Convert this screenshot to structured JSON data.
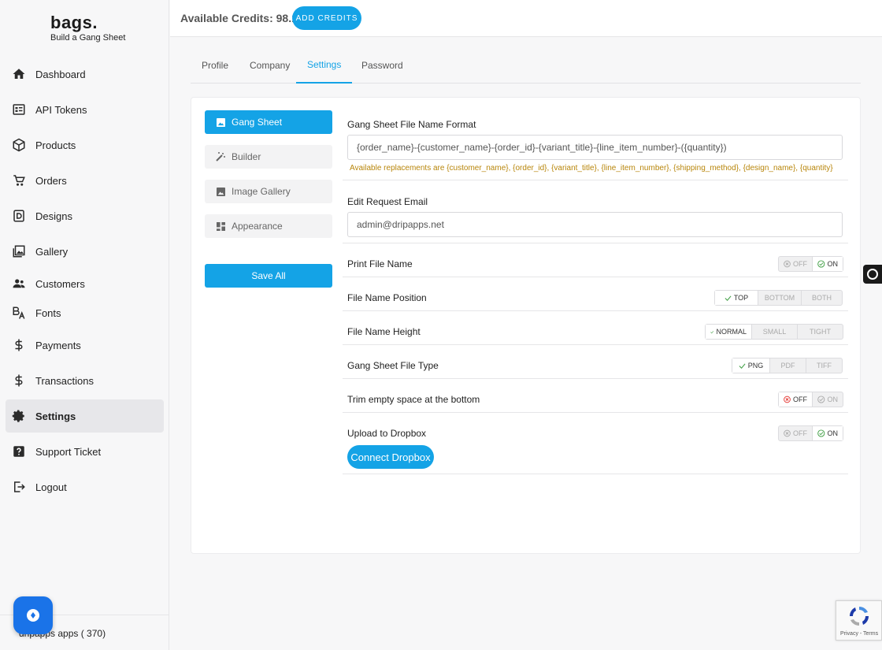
{
  "brand": {
    "name": "bags.",
    "tagline": "Build a Gang Sheet"
  },
  "sidebar": {
    "items": [
      {
        "label": "Dashboard",
        "icon": "home-icon"
      },
      {
        "label": "API Tokens",
        "icon": "api-tokens-icon"
      },
      {
        "label": "Products",
        "icon": "cube-icon"
      },
      {
        "label": "Orders",
        "icon": "cart-icon"
      },
      {
        "label": "Designs",
        "icon": "designs-icon"
      },
      {
        "label": "Gallery",
        "icon": "gallery-icon"
      },
      {
        "label": "Customers",
        "icon": "people-icon"
      },
      {
        "label": "Fonts",
        "icon": "fonts-icon"
      },
      {
        "label": "Payments",
        "icon": "dollar-icon"
      },
      {
        "label": "Transactions",
        "icon": "dollar-icon"
      },
      {
        "label": "Settings",
        "icon": "gear-icon",
        "active": true
      },
      {
        "label": "Support Ticket",
        "icon": "question-icon"
      },
      {
        "label": "Logout",
        "icon": "logout-icon"
      }
    ],
    "footer": "dripapps apps ( 370)"
  },
  "topbar": {
    "credits_label": "Available Credits: 98.11",
    "add_credits": "ADD CREDITS"
  },
  "tabs": [
    "Profile",
    "Company",
    "Settings",
    "Password"
  ],
  "active_tab": "Settings",
  "subnav": {
    "items": [
      "Gang Sheet",
      "Builder",
      "Image Gallery",
      "Appearance"
    ],
    "active": "Gang Sheet",
    "save_all": "Save All"
  },
  "form": {
    "file_name_format": {
      "label": "Gang Sheet File Name Format",
      "value": "{order_name}-{customer_name}-{order_id}-{variant_title}-{line_item_number}-({quantity})",
      "hint": "Available replacements are {customer_name}, {order_id}, {variant_title}, {line_item_number}, {shipping_method}, {design_name}, {quantity}"
    },
    "edit_request_email": {
      "label": "Edit Request Email",
      "value": "admin@dripapps.net"
    },
    "print_file_name": {
      "label": "Print File Name",
      "options": [
        "OFF",
        "ON"
      ],
      "selected": "ON"
    },
    "file_name_position": {
      "label": "File Name Position",
      "options": [
        "TOP",
        "BOTTOM",
        "BOTH"
      ],
      "selected": "TOP"
    },
    "file_name_height": {
      "label": "File Name Height",
      "options": [
        "NORMAL",
        "SMALL",
        "TIGHT"
      ],
      "selected": "NORMAL"
    },
    "file_type": {
      "label": "Gang Sheet File Type",
      "options": [
        "PNG",
        "PDF",
        "TIFF"
      ],
      "selected": "PNG"
    },
    "trim_empty": {
      "label": "Trim empty space at the bottom",
      "options": [
        "OFF",
        "ON"
      ],
      "selected": "OFF"
    },
    "upload_dropbox": {
      "label": "Upload to Dropbox",
      "options": [
        "OFF",
        "ON"
      ],
      "selected": "ON",
      "connect_label": "Connect Dropbox"
    }
  },
  "recaptcha": {
    "links": "Privacy - Terms"
  },
  "colors": {
    "accent": "#14a3e6",
    "off_red": "#e53935",
    "on_green": "#43a047",
    "hint": "#b8860b"
  }
}
